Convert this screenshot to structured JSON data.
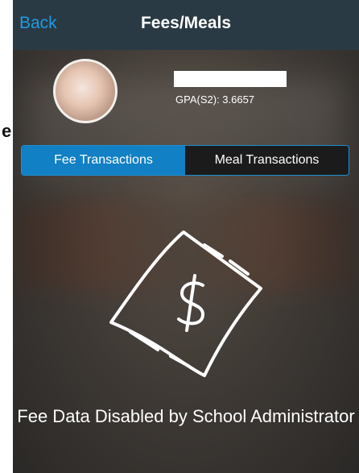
{
  "left_margin": {
    "edge_char": "e"
  },
  "navbar": {
    "back_label": "Back",
    "title": "Fees/Meals"
  },
  "profile": {
    "gpa_text": "GPA(S2): 3.6657"
  },
  "tabs": [
    {
      "label": "Fee Transactions",
      "active": true
    },
    {
      "label": "Meal Transactions",
      "active": false
    }
  ],
  "content": {
    "icon": "money-bill-icon",
    "message": "Fee Data Disabled by School Administrator"
  },
  "colors": {
    "accent": "#1f9be0",
    "navbar_bg": "#2a3a44",
    "active_tab": "#1180c4"
  }
}
